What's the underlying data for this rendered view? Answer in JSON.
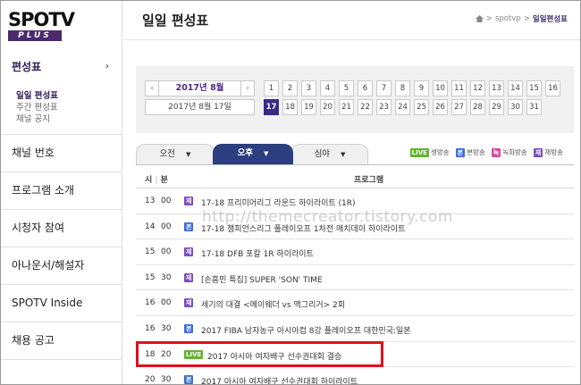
{
  "logo": {
    "line1": "SPOTV",
    "line2": "PLUS"
  },
  "sidebar": {
    "active": {
      "label": "편성표",
      "arrow": "›"
    },
    "subitems": [
      {
        "label": "일일 편성표",
        "on": true
      },
      {
        "label": "주간 편성표",
        "on": false
      },
      {
        "label": "채널 공지",
        "on": false
      }
    ],
    "items": [
      {
        "label": "채널 번호"
      },
      {
        "label": "프로그램 소개"
      },
      {
        "label": "시청자 참여"
      },
      {
        "label": "아나운서/해설자"
      },
      {
        "label": "SPOTV Inside"
      },
      {
        "label": "채용 공고"
      }
    ]
  },
  "header": {
    "title": "일일 편성표",
    "breadcrumb": {
      "home_icon": "home-icon",
      "sep": ">",
      "root": "spotvp",
      "current": "일일편성표"
    }
  },
  "calendar": {
    "prev": "‹",
    "next": "›",
    "month": "2017년 8월",
    "date": "2017년 8월 17일",
    "selected_day": "17",
    "days": [
      "1",
      "2",
      "3",
      "4",
      "5",
      "6",
      "7",
      "8",
      "9",
      "10",
      "11",
      "12",
      "13",
      "14",
      "15",
      "16",
      "17",
      "18",
      "19",
      "20",
      "21",
      "22",
      "23",
      "24",
      "25",
      "26",
      "27",
      "28",
      "29",
      "30",
      "31"
    ]
  },
  "tabs": [
    {
      "label": "오전",
      "caret": "▼"
    },
    {
      "label": "오후",
      "caret": "▼"
    },
    {
      "label": "심야",
      "caret": "▼"
    }
  ],
  "legend": [
    {
      "badge": "LIVE",
      "label": "생방송",
      "color": "#62b52e"
    },
    {
      "badge": "본",
      "label": "본방송",
      "color": "#3b6fd0"
    },
    {
      "badge": "녹",
      "label": "녹화방송",
      "color": "#d94aa0"
    },
    {
      "badge": "재",
      "label": "재방송",
      "color": "#7a4cc2"
    }
  ],
  "table": {
    "headers": {
      "hour": "시",
      "sep": "|",
      "minute": "분",
      "program": "프로그램"
    },
    "rows": [
      {
        "hh": "13",
        "mm": "00",
        "badge": "재",
        "type": "re",
        "title": "17-18 프리미어리그 라운드 하이라이트 (1R)"
      },
      {
        "hh": "14",
        "mm": "00",
        "badge": "본",
        "type": "bon",
        "title": "17-18 챔피언스리그 플레이오프 1차전 매치데이 하이라이트"
      },
      {
        "hh": "15",
        "mm": "00",
        "badge": "재",
        "type": "re",
        "title": "17-18 DFB 포칼 1R 하이라이트"
      },
      {
        "hh": "15",
        "mm": "30",
        "badge": "재",
        "type": "re",
        "title": "[손흥민 특집] SUPER 'SON' TIME"
      },
      {
        "hh": "16",
        "mm": "00",
        "badge": "재",
        "type": "re",
        "title": "세기의 대결 <메이웨더 vs 맥그리거> 2회"
      },
      {
        "hh": "16",
        "mm": "30",
        "badge": "본",
        "type": "bon",
        "title": "2017 FIBA 남자농구 아시아컵 8강 플레이오프 대한민국:일본"
      },
      {
        "hh": "18",
        "mm": "20",
        "badge": "LIVE",
        "type": "live",
        "title": "2017 아시아 여자배구 선수권대회 결승"
      },
      {
        "hh": "20",
        "mm": "30",
        "badge": "본",
        "type": "bon",
        "title": "2017 아시아 여자배구 선수권대회 하이라이트"
      }
    ]
  },
  "watermark": "http://themecreator.tistory.com"
}
